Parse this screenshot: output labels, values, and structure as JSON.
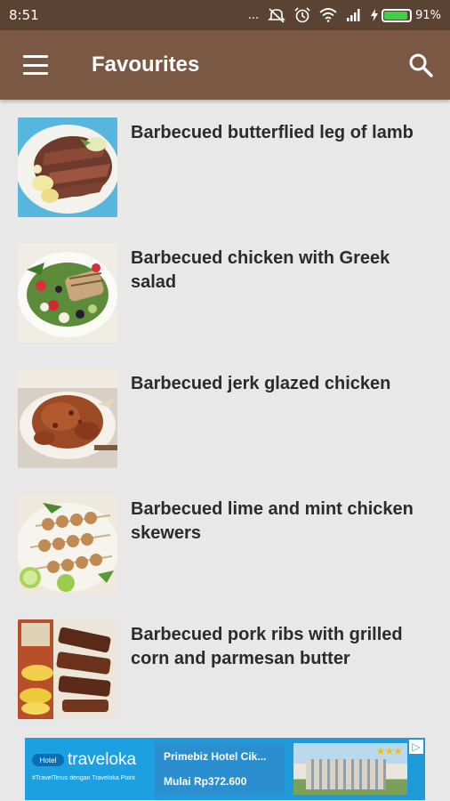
{
  "status_bar": {
    "time": "8:51",
    "dots": "...",
    "battery_pct": "91%",
    "battery_level": 0.91,
    "icons": [
      "mute-icon",
      "alarm-icon",
      "wifi-icon",
      "signal-icon",
      "charging-icon",
      "battery-icon"
    ]
  },
  "app_bar": {
    "title": "Favourites",
    "menu_icon": "hamburger-menu-icon",
    "search_icon": "search-icon",
    "color": "#7a5844"
  },
  "recipes": [
    {
      "title": "Barbecued butterflied leg of lamb",
      "image": "lamb-dish"
    },
    {
      "title": "Barbecued chicken with Greek salad",
      "image": "chicken-salad-dish"
    },
    {
      "title": "Barbecued jerk glazed chicken",
      "image": "roast-chicken-dish"
    },
    {
      "title": "Barbecued lime and mint chicken skewers",
      "image": "chicken-skewers-dish"
    },
    {
      "title": "Barbecued pork ribs with grilled corn and parmesan butter",
      "image": "pork-ribs-dish"
    }
  ],
  "ad": {
    "brand": "traveloka",
    "badge": "Hotel",
    "tagline": "#TravelTerus dengan Traveloka Point",
    "hotel_name": "Primebiz Hotel Cik...",
    "price": "Mulai Rp372.600",
    "stars": "★★★",
    "choices_icon": "ad-choices-icon"
  }
}
